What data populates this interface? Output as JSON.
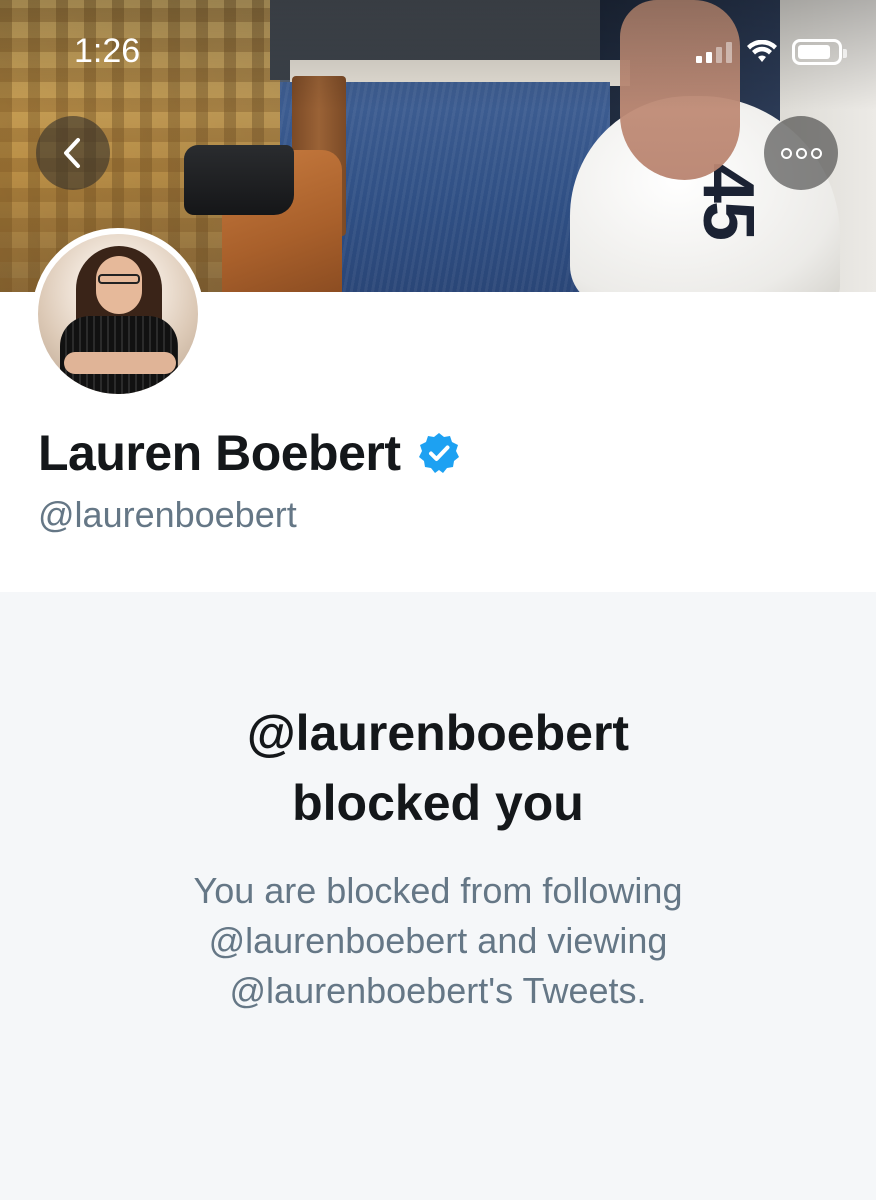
{
  "status_bar": {
    "time": "1:26",
    "signal_bars": 4,
    "signal_bars_active": 2,
    "battery_level": 0.85
  },
  "header": {
    "back_icon": "chevron-left-icon",
    "more_icon": "more-horizontal-icon"
  },
  "profile": {
    "display_name": "Lauren Boebert",
    "verified": true,
    "verified_color": "#1da1f2",
    "handle": "@laurenboebert"
  },
  "blocked": {
    "title_line1": "@laurenboebert",
    "title_line2": "blocked you",
    "description_line1": "You are blocked from following",
    "description_line2": "@laurenboebert and viewing",
    "description_line3": "@laurenboebert's Tweets."
  },
  "colors": {
    "text_primary": "#14171a",
    "text_secondary": "#657786",
    "page_background": "#f5f7f9"
  }
}
